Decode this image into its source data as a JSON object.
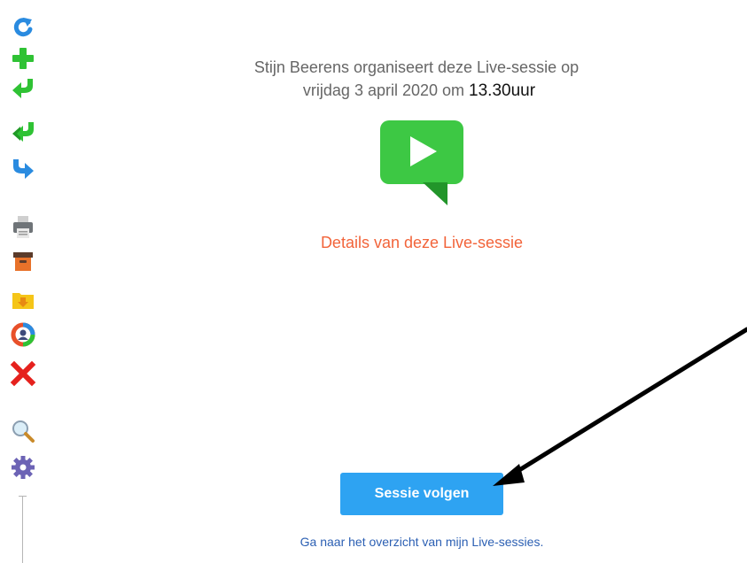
{
  "toolbar": {
    "icons": [
      "refresh-icon",
      "add-icon",
      "reply-icon",
      "reply-all-icon",
      "forward-icon",
      "print-icon",
      "archive-icon",
      "download-folder-icon",
      "user-circle-icon",
      "delete-icon",
      "search-icon",
      "settings-icon"
    ]
  },
  "session": {
    "organizer_text": "Stijn Beerens organiseert deze Live-sessie op",
    "date_text": "vrijdag 3 april 2020 om",
    "time_text": "13.30uur",
    "details_link": "Details van deze Live-sessie",
    "follow_button": "Sessie volgen",
    "overview_link": "Ga naar het overzicht van mijn Live-sessies."
  },
  "colors": {
    "accent_blue": "#2ea3f2",
    "details_orange": "#f2643a",
    "play_green": "#3dc844",
    "link_blue": "#2b5fb3"
  }
}
